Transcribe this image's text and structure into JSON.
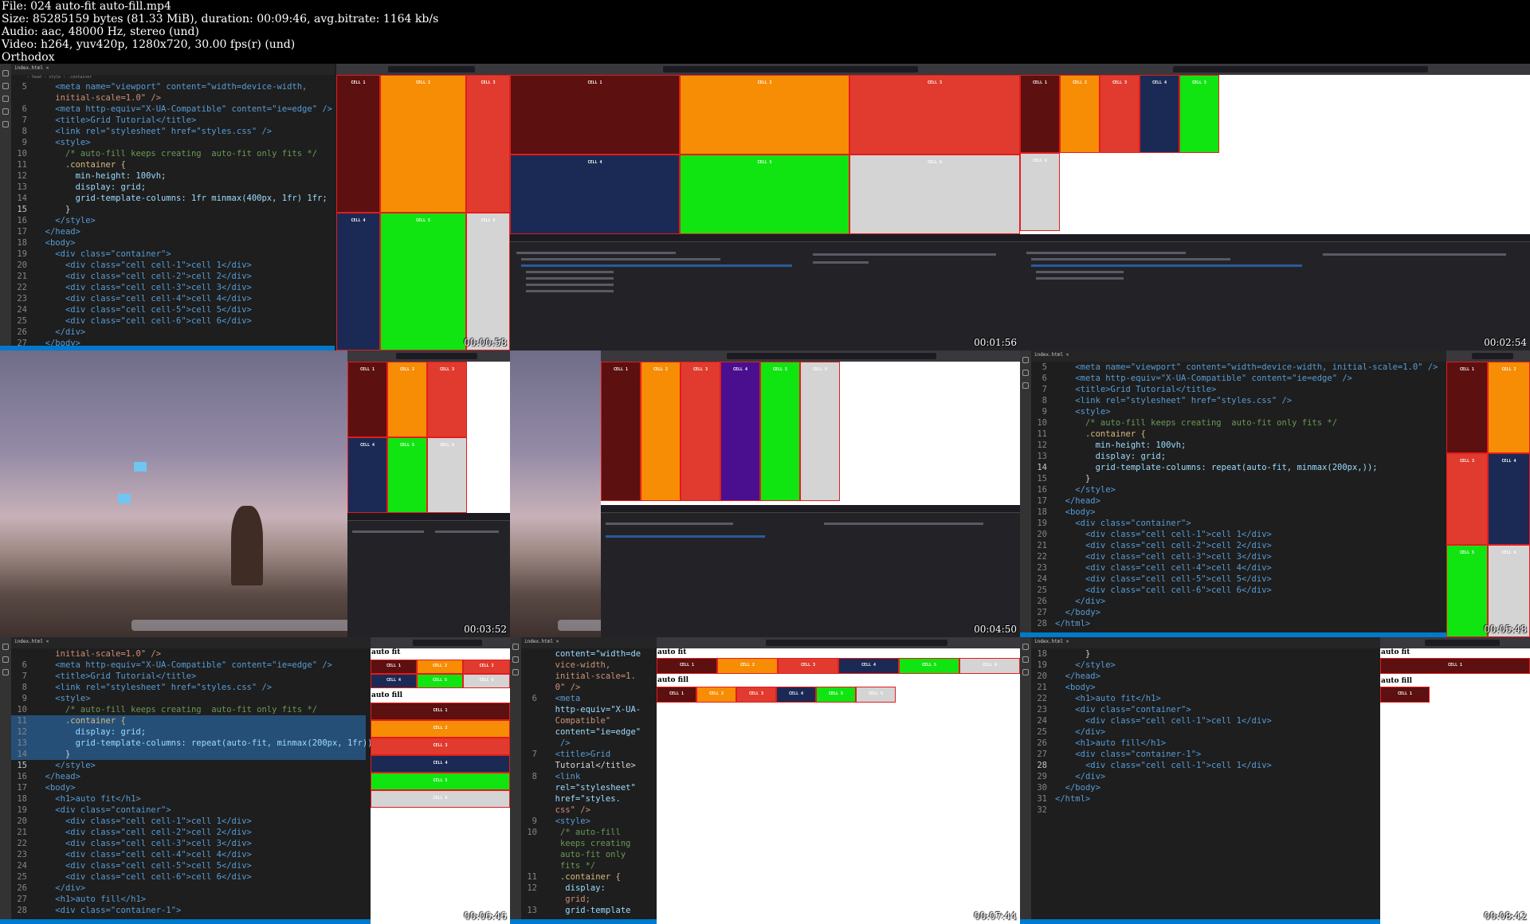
{
  "file_info": {
    "line1": "File: 024 auto-fit auto-fill.mp4",
    "line2": "Size: 85285159 bytes (81.33 MiB), duration: 00:09:46, avg.bitrate: 1164 kb/s",
    "line3": "Audio: aac, 48000 Hz, stereo (und)",
    "line4": "Video: h264, yuv420p, 1280x720, 30.00 fps(r) (und)",
    "line5": "Orthodox"
  },
  "timestamps": [
    "00:00:58",
    "00:01:56",
    "00:02:54",
    "00:03:52",
    "00:04:50",
    "00:05:48",
    "00:06:46",
    "00:07:44",
    "00:08:42"
  ],
  "cell_labels": [
    "CELL 1",
    "CELL 2",
    "CELL 3",
    "CELL 4",
    "CELL 5",
    "CELL 6"
  ],
  "colors": {
    "cell1": "#5c1010",
    "cell2": "#f78c05",
    "cell3": "#e03b2e",
    "cell4": "#1b2a55",
    "cell5": "#11e511",
    "cell6": "#d4d4d4",
    "cell4_purple": "#4a0f8f"
  },
  "headings": {
    "auto_fit": "auto fit",
    "auto_fill": "auto fill"
  },
  "code_a": {
    "l5": "<meta name=\"viewport\" content=\"width=device-width,",
    "l5b": "initial-scale=1.0\" />",
    "l6": "<meta http-equiv=\"X-UA-Compatible\" content=\"ie=edge\" />",
    "l7": "<title>Grid Tutorial</title>",
    "l8": "<link rel=\"stylesheet\" href=\"styles.css\" />",
    "l9": "<style>",
    "l10": "/* auto-fill keeps creating  auto-fit only fits */",
    "l11": ".container {",
    "l12": "min-height: 100vh;",
    "l13": "display: grid;",
    "l14": "grid-template-columns: 1fr minmax(400px, 1fr) 1fr;",
    "l15": "}",
    "l16": "</style>",
    "l17": "</head>",
    "l18": "<body>",
    "l19": "<div class=\"container\">",
    "l20": "<div class=\"cell cell-1\">cell 1</div>",
    "l21": "<div class=\"cell cell-2\">cell 2</div>",
    "l22": "<div class=\"cell cell-3\">cell 3</div>",
    "l23": "<div class=\"cell cell-4\">cell 4</div>",
    "l24": "<div class=\"cell cell-5\">cell 5</div>",
    "l25": "<div class=\"cell cell-6\">cell 6</div>",
    "l26": "</div>",
    "l27": "</body>"
  },
  "code_f": {
    "l5": "<meta name=\"viewport\" content=\"width=device-width, initial-scale=1.0\" />",
    "l6": "<meta http-equiv=\"X-UA-Compatible\" content=\"ie=edge\" />",
    "l7": "<title>Grid Tutorial</title>",
    "l8": "<link rel=\"stylesheet\" href=\"styles.css\" />",
    "l9": "<style>",
    "l10": "/* auto-fill keeps creating  auto-fit only fits */",
    "l11": ".container {",
    "l12": "min-height: 100vh;",
    "l13": "display: grid;",
    "l14": "grid-template-columns: repeat(auto-fit, minmax(200px,));",
    "l15": "}",
    "l16": "</style>",
    "l17": "</head>",
    "l18": "<body>",
    "l19": "<div class=\"container\">",
    "l20": "<div class=\"cell cell-1\">cell 1</div>",
    "l21": "<div class=\"cell cell-2\">cell 2</div>",
    "l22": "<div class=\"cell cell-3\">cell 3</div>",
    "l23": "<div class=\"cell cell-4\">cell 4</div>",
    "l24": "<div class=\"cell cell-5\">cell 5</div>",
    "l25": "<div class=\"cell cell-6\">cell 6</div>",
    "l26": "</div>",
    "l27": "</body>",
    "l28": "</html>"
  },
  "code_g": {
    "l5": "initial-scale=1.0\" />",
    "l6": "<meta http-equiv=\"X-UA-Compatible\" content=\"ie=edge\" />",
    "l7": "<title>Grid Tutorial</title>",
    "l8": "<link rel=\"stylesheet\" href=\"styles.css\" />",
    "l9": "<style>",
    "l10": "/* auto-fill keeps creating  auto-fit only fits */",
    "l11": ".container {",
    "l12": "display: grid;",
    "l13": "grid-template-columns: repeat(auto-fit, minmax(200px, 1fr));",
    "l14": "}",
    "l15": "</style>",
    "l16": "</head>",
    "l17": "<body>",
    "l18": "<h1>auto fit</h1>",
    "l19": "<div class=\"container\">",
    "l20": "<div class=\"cell cell-1\">cell 1</div>",
    "l21": "<div class=\"cell cell-2\">cell 2</div>",
    "l22": "<div class=\"cell cell-3\">cell 3</div>",
    "l23": "<div class=\"cell cell-4\">cell 4</div>",
    "l24": "<div class=\"cell cell-5\">cell 5</div>",
    "l25": "<div class=\"cell cell-6\">cell 6</div>",
    "l26": "</div>",
    "l27": "<h1>auto fill</h1>",
    "l28": "<div class=\"container-1\">"
  },
  "code_h": {
    "a": "content=\"width=de",
    "b": "vice-width,",
    "c": "initial-scale=1.",
    "d": "0\" />",
    "e": "<meta",
    "f": "http-equiv=\"X-UA-",
    "g": "Compatible\"",
    "h": "content=\"ie=edge\"",
    "i": "/>",
    "j": "<title>Grid",
    "k": "Tutorial</title>",
    "l": "<link",
    "m": "rel=\"stylesheet\"",
    "n": "href=\"styles.",
    "o": "css\" />",
    "p": "<style>",
    "q": "/* auto-fill",
    "r": "keeps creating",
    "s": "auto-fit only",
    "t": "fits */",
    "u": ".container {",
    "v": "display:",
    "w": "grid;",
    "x": "grid-template"
  },
  "code_i": {
    "l18": "}",
    "l19": "</style>",
    "l20": "</head>",
    "l21": "<body>",
    "l22": "<h1>auto fit</h1>",
    "l23": "<div class=\"container\">",
    "l24": "<div class=\"cell cell-1\">cell 1</div>",
    "l25": "</div>",
    "l26": "<h1>auto fill</h1>",
    "l27": "<div class=\"container-1\">",
    "l28": "<div class=\"cell cell-1\">cell 1</div>",
    "l29": "</div>",
    "l30": "</body>",
    "l31": "</html>",
    "l32": ""
  }
}
